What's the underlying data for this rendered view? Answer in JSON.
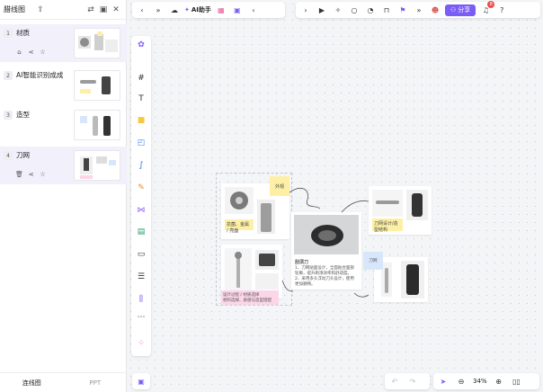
{
  "panel": {
    "title": "腊线图",
    "slides": [
      {
        "num": "1",
        "title": "材质"
      },
      {
        "num": "2",
        "title": "AI智能识别成成"
      },
      {
        "num": "3",
        "title": "造型"
      },
      {
        "num": "4",
        "title": "刀网"
      }
    ],
    "footer": {
      "tab_active": "连线图",
      "tab_other": "PPT"
    }
  },
  "topbar": {
    "ai_label": "AI助手",
    "share_label": "分享",
    "notif_count": "8"
  },
  "canvas": {
    "sticky_top": "外观",
    "sticky_yellow_left": "抗菌、金属 / 亮面",
    "card_heading": "刮须刀",
    "card_line1": "1、刀网贴面设计，全面贴合面部轮廓，提升剃须效率和舒适度。",
    "card_line2": "2、采用多头浮动刀头设计，使用更加顺畅。",
    "sticky_right": "刀网设计/造型结构",
    "sticky_blue": "刀网",
    "sticky_pink_line1": "设计过程 / 材质选择",
    "sticky_pink_line2": "材料选择、质感与造型搭配"
  },
  "zoom": {
    "level": "34%"
  }
}
